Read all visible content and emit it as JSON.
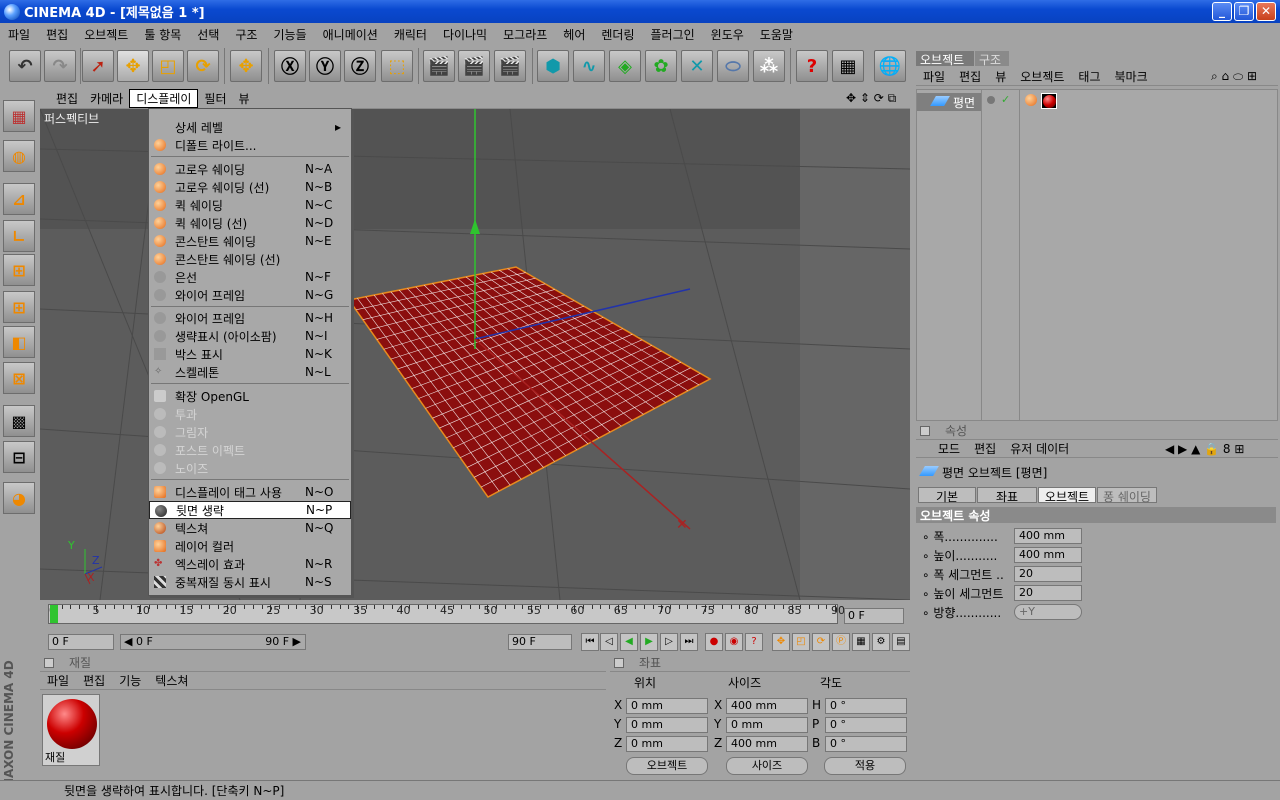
{
  "window": {
    "title": "CINEMA 4D - [제목없음 1 *]"
  },
  "menubar": [
    "파일",
    "편집",
    "오브젝트",
    "툴 항목",
    "선택",
    "구조",
    "기능들",
    "애니메이션",
    "캐릭터",
    "다이나믹",
    "모그라프",
    "헤어",
    "렌더링",
    "플러그인",
    "윈도우",
    "도움말"
  ],
  "viewport": {
    "menu": [
      "편집",
      "카메라",
      "디스플레이",
      "필터",
      "뷰"
    ],
    "label": "퍼스펙티브"
  },
  "display_menu": {
    "items": [
      {
        "label": "상세 레벨",
        "shortcut": "",
        "submenu": "▸"
      },
      {
        "label": "디폴트 라이트...",
        "shortcut": ""
      },
      {
        "label": "고로우 쉐이딩",
        "shortcut": "N~A"
      },
      {
        "label": "고로우 쉐이딩 (선)",
        "shortcut": "N~B"
      },
      {
        "label": "퀵 쉐이딩",
        "shortcut": "N~C"
      },
      {
        "label": "퀵 쉐이딩 (선)",
        "shortcut": "N~D"
      },
      {
        "label": "콘스탄트 쉐이딩",
        "shortcut": "N~E"
      },
      {
        "label": "콘스탄트 쉐이딩 (선)",
        "shortcut": ""
      },
      {
        "label": "은선",
        "shortcut": "N~F"
      },
      {
        "label": "와이어 프레임",
        "shortcut": "N~G"
      },
      {
        "label": "와이어 프레임",
        "shortcut": "N~H"
      },
      {
        "label": "생략표시 (아이소팜)",
        "shortcut": "N~I"
      },
      {
        "label": "박스 표시",
        "shortcut": "N~K"
      },
      {
        "label": "스켈레톤",
        "shortcut": "N~L"
      },
      {
        "label": "확장 OpenGL",
        "shortcut": ""
      },
      {
        "label": "투과",
        "shortcut": ""
      },
      {
        "label": "그림자",
        "shortcut": ""
      },
      {
        "label": "포스트 이펙트",
        "shortcut": ""
      },
      {
        "label": "노이즈",
        "shortcut": ""
      },
      {
        "label": "디스플레이 태그 사용",
        "shortcut": "N~O"
      },
      {
        "label": "뒷면 생략",
        "shortcut": "N~P"
      },
      {
        "label": "텍스쳐",
        "shortcut": "N~Q"
      },
      {
        "label": "레이어 컬러",
        "shortcut": ""
      },
      {
        "label": "엑스레이 효과",
        "shortcut": "N~R"
      },
      {
        "label": "중복재질 동시 표시",
        "shortcut": "N~S"
      }
    ]
  },
  "timeline": {
    "ticks": [
      "0",
      "5",
      "10",
      "15",
      "20",
      "25",
      "30",
      "35",
      "40",
      "45",
      "50",
      "55",
      "60",
      "65",
      "70",
      "75",
      "80",
      "85",
      "90"
    ],
    "current_frame": "0 F",
    "start_field": "0 F",
    "range_left": "◀ 0 F",
    "range_right": "90 F ▶",
    "end_field": "90 F"
  },
  "material_panel": {
    "title": "재질",
    "menu": [
      "파일",
      "편집",
      "기능",
      "텍스쳐"
    ],
    "material_name": "재질"
  },
  "coord_panel": {
    "title": "좌표",
    "headers": [
      "위치",
      "사이즈",
      "각도"
    ],
    "pos": [
      {
        "axis": "X",
        "value": "0 mm"
      },
      {
        "axis": "Y",
        "value": "0 mm"
      },
      {
        "axis": "Z",
        "value": "0 mm"
      }
    ],
    "size": [
      {
        "axis": "X",
        "value": "400 mm"
      },
      {
        "axis": "Y",
        "value": "0 mm"
      },
      {
        "axis": "Z",
        "value": "400 mm"
      }
    ],
    "rot": [
      {
        "axis": "H",
        "value": "0 °"
      },
      {
        "axis": "P",
        "value": "0 °"
      },
      {
        "axis": "B",
        "value": "0 °"
      }
    ],
    "mode_dropdown": "오브젝트",
    "size_dropdown": "사이즈",
    "apply_button": "적용"
  },
  "object_manager": {
    "tabs": [
      "오브젝트",
      "구조"
    ],
    "menu": [
      "파일",
      "편집",
      "뷰",
      "오브젝트",
      "태그",
      "북마크"
    ],
    "object_name": "평면"
  },
  "attributes": {
    "title": "속성",
    "menu": [
      "모드",
      "편집",
      "유저 데이터"
    ],
    "object_title": "평면 오브젝트 [평면]",
    "tabs": [
      "기본",
      "좌표",
      "오브젝트",
      "퐁 쉐이딩"
    ],
    "section": "오브젝트 속성",
    "rows": [
      {
        "label": "폭..............",
        "value": "400 mm"
      },
      {
        "label": "높이...........",
        "value": "400 mm"
      },
      {
        "label": "폭 세그먼트 ..",
        "value": "20"
      },
      {
        "label": "높이 세그먼트",
        "value": "20"
      },
      {
        "label": "방향............",
        "value": "+Y"
      }
    ]
  },
  "status": {
    "text": "뒷면을 생략하여 표시합니다. [단축키 N~P]"
  },
  "brand": "MAXON CINEMA 4D",
  "colors": {
    "title_blue": "#0a49d0",
    "plane_red": "#8b0e0e",
    "viewport_bg": "#5a5a5a"
  }
}
